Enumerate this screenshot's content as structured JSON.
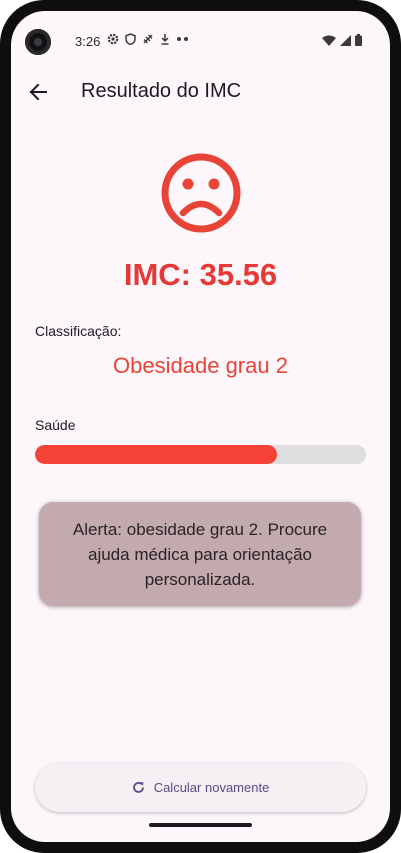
{
  "status_bar": {
    "time": "3:26",
    "left_icons": [
      "gear-icon",
      "shield-icon",
      "satellite-icon",
      "download-icon",
      "more-dots-icon"
    ],
    "right_icons": [
      "wifi-icon",
      "signal-icon",
      "battery-icon"
    ]
  },
  "app_bar": {
    "back_icon": "arrow-back-icon",
    "title": "Resultado do IMC"
  },
  "result": {
    "face_icon": "sad-face-icon",
    "imc_text": "IMC: 35.56",
    "classification_label": "Classificação:",
    "classification_value": "Obesidade grau 2",
    "health_label": "Saúde",
    "health_level": 0.73,
    "alert_text": "Alerta: obesidade grau 2. Procure ajuda médica para orientação personalizada."
  },
  "actions": {
    "recalc_icon": "refresh-icon",
    "recalc_label": "Calcular novamente"
  },
  "colors": {
    "accent_red": "#e53935",
    "bar_fill": "#f44336",
    "bar_track": "#dedde0",
    "alert_bg": "#c2aaae",
    "screen_bg": "#fdf6fb",
    "button_text": "#5b4a8a"
  }
}
